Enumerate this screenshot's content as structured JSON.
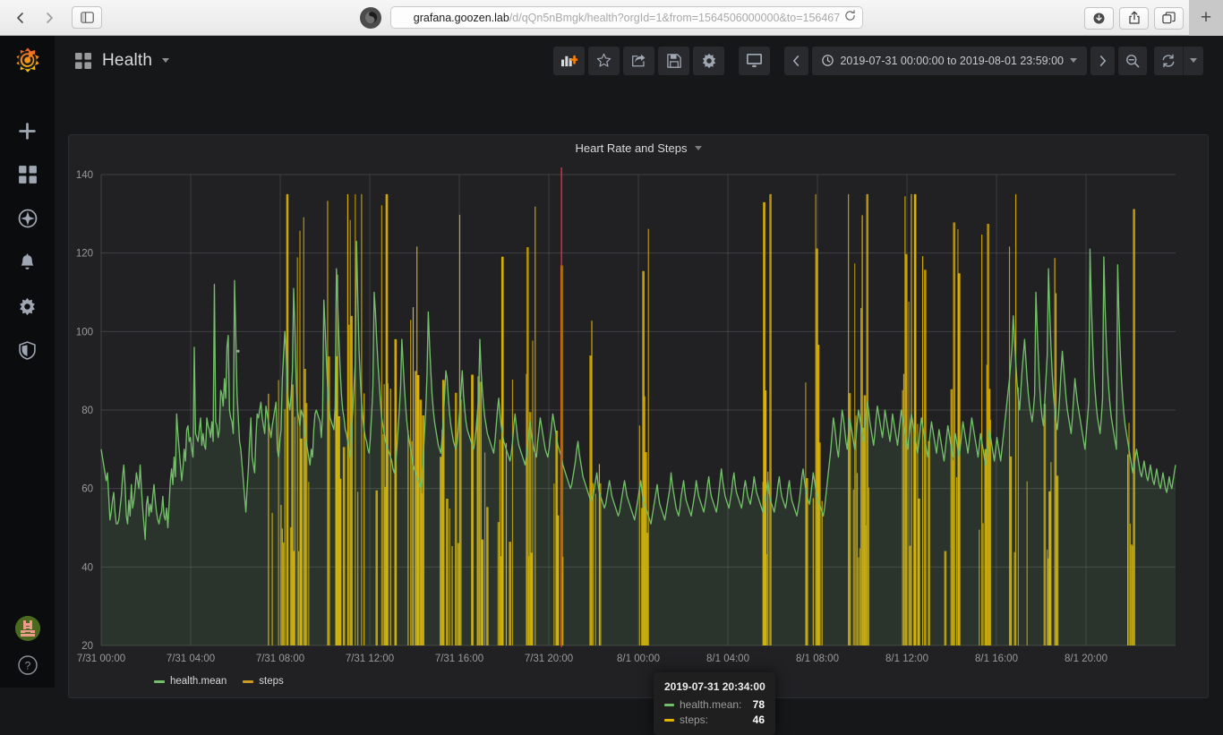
{
  "browser": {
    "back_icon": "chevron-left-icon",
    "forward_icon": "chevron-right-icon",
    "sidebar_icon": "sidebar-panel-icon",
    "privacy_icon": "privacy-report-icon",
    "url_host": "grafana.goozen.lab",
    "url_path": "/d/qQn5nBmgk/health?orgId=1&from=1564506000000&to=156467",
    "url_full": "grafana.goozen.lab/d/qQn5nBmgk/health?orgId=1&from=1564506000000&to=156467",
    "reload_icon": "reload-icon",
    "download_icon": "downloads-icon",
    "share_icon": "share-icon",
    "tabs_icon": "tab-overview-icon",
    "newtab_label": "+"
  },
  "sidebar": {
    "logo_name": "grafana-logo",
    "items": [
      {
        "name": "create-icon",
        "label": "Create"
      },
      {
        "name": "dashboards-icon",
        "label": "Dashboards"
      },
      {
        "name": "explore-icon",
        "label": "Explore"
      },
      {
        "name": "alerting-bell-icon",
        "label": "Alerting"
      },
      {
        "name": "configuration-gear-icon",
        "label": "Configuration"
      },
      {
        "name": "server-admin-shield-icon",
        "label": "Server Admin"
      }
    ],
    "avatar_name": "user-avatar",
    "help_label": "?"
  },
  "dashnav": {
    "grid_icon": "dashboard-grid-icon",
    "title": "Health",
    "caret_icon": "chevron-down-icon",
    "toolbar": [
      {
        "name": "add-panel-button",
        "label": "Add panel"
      },
      {
        "name": "mark-favorite-button",
        "label": "Mark as favorite"
      },
      {
        "name": "share-dashboard-button",
        "label": "Share dashboard"
      },
      {
        "name": "save-dashboard-button",
        "label": "Save dashboard"
      },
      {
        "name": "dashboard-settings-button",
        "label": "Dashboard settings"
      },
      {
        "name": "cycle-view-mode-button",
        "label": "Cycle view mode"
      }
    ],
    "time_prev_label": "Move time range back",
    "time_next_label": "Move time range forward",
    "time_clock_icon": "clock-icon",
    "time_range": "2019-07-31 00:00:00 to 2019-08-01 23:59:00",
    "time_caret_icon": "chevron-down-icon",
    "zoom_out_label": "Zoom out time range",
    "refresh_label": "Refresh dashboard",
    "refresh_caret_icon": "chevron-down-icon"
  },
  "panel": {
    "title": "Heart Rate and Steps",
    "menu_caret_icon": "chevron-down-icon"
  },
  "tooltip": {
    "time": "2019-07-31 20:34:00",
    "rows": [
      {
        "label": "health.mean:",
        "value": "78",
        "color": "#73bf69"
      },
      {
        "label": "steps:",
        "value": "46",
        "color": "#e0b400"
      }
    ]
  },
  "legend": [
    {
      "label": "health.mean",
      "color": "#73bf69"
    },
    {
      "label": "steps",
      "color": "#cc9a1e"
    }
  ],
  "colors": {
    "health_line": "#73bf69",
    "health_fill": "rgba(115,191,105,0.12)",
    "steps_bar": "#e0b400",
    "crosshair": "#e02f44",
    "grid": "#5a5a5a",
    "panel_bg": "#212124",
    "page_bg": "#161719"
  },
  "chart_data": {
    "type": "line",
    "title": "Heart Rate and Steps",
    "xlabel": "",
    "ylabel": "",
    "ylim": [
      20,
      140
    ],
    "yticks": [
      20,
      40,
      60,
      80,
      100,
      120,
      140
    ],
    "xticks": [
      "7/31 00:00",
      "7/31 04:00",
      "7/31 08:00",
      "7/31 12:00",
      "7/31 16:00",
      "7/31 20:00",
      "8/1 00:00",
      "8/1 04:00",
      "8/1 08:00",
      "8/1 12:00",
      "8/1 16:00",
      "8/1 20:00"
    ],
    "grid": true,
    "legend_position": "bottom-left",
    "x_start": "2019-07-31 00:00:00",
    "x_end": "2019-08-01 23:59:00",
    "annotations": [
      {
        "name": "crosshair",
        "x": "2019-07-31 20:34:00",
        "color": "#e02f44"
      }
    ],
    "series": [
      {
        "name": "health.mean",
        "type": "line",
        "color": "#73bf69",
        "fill": true,
        "values": [
          70,
          68,
          66,
          64,
          62,
          64,
          58,
          52,
          54,
          57,
          59,
          54,
          51,
          51,
          52,
          55,
          58,
          63,
          66,
          61,
          53,
          51,
          57,
          53,
          61,
          55,
          57,
          60,
          64,
          62,
          60,
          66,
          60,
          55,
          51,
          47,
          56,
          58,
          53,
          56,
          54,
          58,
          61,
          57,
          54,
          52,
          51,
          53,
          54,
          58,
          53,
          52,
          55,
          50,
          56,
          62,
          65,
          61,
          68,
          63,
          79,
          74,
          70,
          66,
          62,
          65,
          70,
          67,
          75,
          76,
          72,
          73,
          70,
          68,
          96,
          74,
          73,
          72,
          75,
          78,
          71,
          74,
          71,
          70,
          78,
          76,
          75,
          73,
          77,
          72,
          112,
          77,
          76,
          73,
          75,
          85,
          84,
          81,
          88,
          83,
          96,
          99,
          80,
          78,
          77,
          74,
          113,
          99,
          84,
          78,
          72,
          70,
          66,
          62,
          58,
          54,
          60,
          65,
          72,
          78,
          68,
          66,
          64,
          73,
          79,
          78,
          80,
          82,
          78,
          76,
          74,
          81,
          79,
          77,
          75,
          73,
          76,
          78,
          80,
          82,
          70,
          68,
          72,
          75,
          88,
          94,
          100,
          95,
          85,
          82,
          80,
          84,
          90,
          111,
          101,
          88,
          80,
          78,
          76,
          80,
          79,
          78,
          74,
          72,
          70,
          68,
          66,
          70,
          68,
          75,
          79,
          80,
          79,
          78,
          77,
          73,
          79,
          108,
          101,
          93,
          86,
          81,
          78,
          77,
          76,
          75,
          81,
          116,
          107,
          98,
          90,
          84,
          80,
          78,
          75,
          74,
          72,
          70,
          68,
          75,
          80,
          86,
          92,
          123,
          108,
          95,
          88,
          82,
          78,
          75,
          73,
          72,
          70,
          69,
          73,
          79,
          86,
          110,
          105,
          98,
          92,
          87,
          82,
          78,
          76,
          74,
          72,
          71,
          70,
          69,
          68,
          67,
          65,
          64,
          66,
          70,
          75,
          80,
          86,
          98,
          92,
          86,
          81,
          77,
          74,
          72,
          70,
          68,
          66,
          65,
          64,
          63,
          62,
          61,
          60,
          63,
          68,
          74,
          80,
          89,
          105,
          97,
          90,
          84,
          80,
          77,
          75,
          73,
          71,
          70,
          69,
          73,
          78,
          84,
          90,
          88,
          83,
          79,
          76,
          74,
          72,
          71,
          70,
          72,
          76,
          80,
          85,
          90,
          84,
          80,
          77,
          75,
          74,
          73,
          72,
          71,
          70,
          72,
          75,
          79,
          83,
          98,
          90,
          85,
          81,
          78,
          76,
          74,
          73,
          72,
          71,
          70,
          69,
          72,
          76,
          80,
          83,
          79,
          76,
          74,
          72,
          71,
          70,
          69,
          68,
          67,
          69,
          72,
          76,
          79,
          76,
          73,
          71,
          70,
          69,
          68,
          67,
          66,
          68,
          71,
          74,
          77,
          74,
          72,
          70,
          69,
          68,
          72,
          75,
          78,
          76,
          74,
          72,
          70,
          69,
          68,
          70,
          73,
          76,
          79,
          77,
          75,
          73,
          71,
          70,
          69,
          68,
          66,
          65,
          64,
          63,
          62,
          61,
          60,
          61,
          63,
          65,
          67,
          70,
          72,
          69,
          67,
          65,
          63,
          62,
          61,
          60,
          59,
          58,
          57,
          57,
          58,
          60,
          62,
          64,
          61,
          59,
          58,
          57,
          56,
          55,
          56,
          58,
          60,
          62,
          60,
          58,
          57,
          56,
          55,
          54,
          53,
          54,
          56,
          58,
          60,
          62,
          60,
          58,
          57,
          56,
          55,
          54,
          53,
          52,
          54,
          56,
          58,
          60,
          62,
          59,
          57,
          56,
          55,
          54,
          53,
          52,
          51,
          53,
          55,
          57,
          59,
          61,
          58,
          56,
          55,
          54,
          53,
          52,
          54,
          56,
          58,
          60,
          64,
          61,
          59,
          57,
          55,
          54,
          53,
          55,
          58,
          60,
          62,
          59,
          57,
          56,
          55,
          54,
          53,
          55,
          57,
          59,
          62,
          60,
          58,
          57,
          56,
          55,
          54,
          56,
          58,
          61,
          63,
          60,
          58,
          57,
          56,
          55,
          54,
          56,
          59,
          62,
          65,
          62,
          60,
          58,
          57,
          56,
          55,
          57,
          59,
          62,
          64,
          61,
          59,
          58,
          57,
          56,
          55,
          57,
          60,
          62,
          60,
          58,
          57,
          56,
          58,
          60,
          63,
          61,
          59,
          58,
          57,
          56,
          55,
          54,
          56,
          58,
          60,
          62,
          59,
          57,
          56,
          55,
          54,
          56,
          58,
          61,
          63,
          60,
          58,
          57,
          56,
          55,
          57,
          60,
          62,
          59,
          57,
          56,
          55,
          54,
          53,
          55,
          57,
          60,
          63,
          65,
          62,
          60,
          58,
          57,
          56,
          58,
          61,
          64,
          62,
          60,
          58,
          57,
          56,
          55,
          54,
          53,
          55,
          58,
          61,
          64,
          67,
          70,
          74,
          78,
          76,
          73,
          70,
          68,
          72,
          76,
          80,
          78,
          75,
          72,
          70,
          74,
          78,
          76,
          74,
          72,
          70,
          73,
          77,
          80,
          78,
          76,
          74,
          72,
          75,
          79,
          82,
          80,
          77,
          75,
          73,
          71,
          74,
          78,
          81,
          79,
          77,
          75,
          73,
          76,
          80,
          78,
          76,
          74,
          72,
          75,
          79,
          77,
          75,
          73,
          71,
          74,
          77,
          80,
          78,
          76,
          74,
          72,
          70,
          73,
          76,
          79,
          77,
          75,
          73,
          71,
          69,
          72,
          75,
          78,
          76,
          74,
          72,
          70,
          68,
          71,
          74,
          77,
          75,
          73,
          71,
          69,
          72,
          75,
          73,
          71,
          69,
          67,
          70,
          73,
          76,
          74,
          72,
          70,
          68,
          71,
          74,
          72,
          70,
          68,
          71,
          74,
          77,
          75,
          73,
          71,
          69,
          72,
          75,
          78,
          76,
          74,
          72,
          70,
          68,
          71,
          74,
          72,
          70,
          68,
          66,
          69,
          72,
          75,
          73,
          71,
          69,
          67,
          70,
          73,
          71,
          69,
          67,
          70,
          73,
          76,
          79,
          82,
          85,
          88,
          92,
          96,
          104,
          98,
          92,
          87,
          83,
          80,
          85,
          90,
          94,
          98,
          93,
          88,
          84,
          81,
          79,
          77,
          80,
          84,
          110,
          101,
          93,
          86,
          81,
          78,
          76,
          82,
          88,
          94,
          116,
          105,
          96,
          89,
          84,
          80,
          77,
          75,
          79,
          84,
          90,
          95,
          91,
          87,
          83,
          80,
          78,
          76,
          74,
          78,
          83,
          88,
          85,
          82,
          80,
          78,
          76,
          74,
          72,
          70,
          74,
          78,
          82,
          121,
          108,
          98,
          90,
          85,
          81,
          78,
          76,
          74,
          78,
          83,
          119,
          106,
          97,
          90,
          85,
          81,
          78,
          76,
          74,
          72,
          70,
          117,
          104,
          95,
          88,
          83,
          79,
          76,
          74,
          72,
          70,
          68,
          66,
          64,
          66,
          68,
          70,
          68,
          66,
          64,
          63,
          65,
          67,
          65,
          63,
          62,
          64,
          66,
          64,
          62,
          61,
          63,
          65,
          63,
          61,
          60,
          62,
          64,
          62,
          60,
          59,
          61,
          63,
          61,
          60,
          62,
          64,
          66
        ]
      },
      {
        "name": "steps",
        "type": "bars",
        "color": "#e0b400",
        "note": "Sparse vertical bars from baseline; most values 0, spikes up to ~120+"
      }
    ]
  }
}
